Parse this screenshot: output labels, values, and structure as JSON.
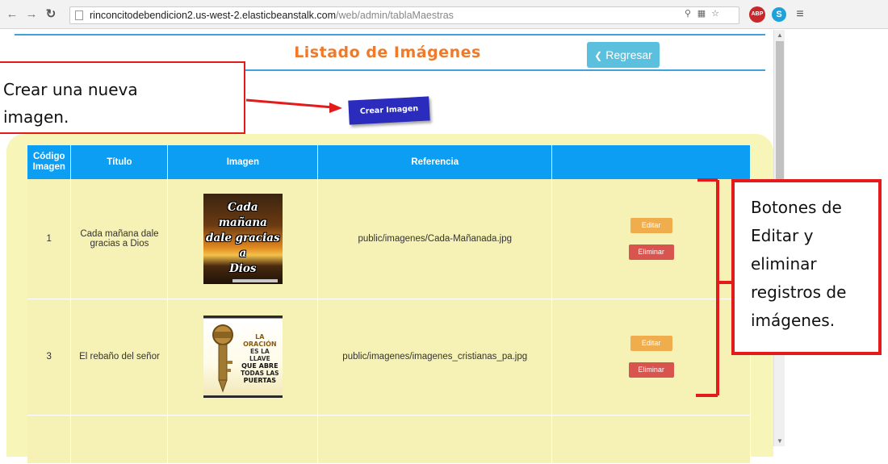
{
  "browser": {
    "url_host": "rinconcitodebendicion2.us-west-2.elasticbeanstalk.com",
    "url_path": "/web/admin/tablaMaestras"
  },
  "page": {
    "title": "Listado de Imágenes",
    "back_button_label": "Regresar",
    "create_button_label": "Crear Imagen"
  },
  "table": {
    "headers": [
      "Código Imagen",
      "Título",
      "Imagen",
      "Referencia",
      ""
    ],
    "rows": [
      {
        "code": "1",
        "title": "Cada mañana dale gracias a Dios",
        "image_text": [
          "Cada mañana",
          "dale gracias a",
          "Dios"
        ],
        "reference": "public/imagenes/Cada-Mañanada.jpg",
        "edit_label": "Editar",
        "delete_label": "Eliminar"
      },
      {
        "code": "3",
        "title": "El rebaño del señor",
        "image_text": [
          "LA ORACIÓN",
          "ES LA LLAVE",
          "QUE ABRE",
          "TODAS LAS",
          "PUERTAS"
        ],
        "reference": "public/imagenes/imagenes_cristianas_pa.jpg",
        "edit_label": "Editar",
        "delete_label": "Eliminar"
      }
    ]
  },
  "annotations": {
    "left_callout_line1": "Crear una nueva",
    "left_callout_line2": "imagen.",
    "right_callout_lines": [
      "Botones de",
      "Editar y",
      "eliminar",
      "registros de",
      "imágenes."
    ],
    "color": "#e31b1b"
  },
  "colors": {
    "header_blue": "#0b9ef3",
    "panel_yellow": "#f8f5b8",
    "title_orange": "#f07a2a",
    "back_button": "#5bc0de",
    "create_button": "#2b2bbd",
    "edit_button": "#f0ad4e",
    "delete_button": "#d9534f"
  },
  "icons": {
    "back": "arrow-left-icon",
    "forward": "arrow-right-icon",
    "reload": "reload-icon",
    "page": "page-icon",
    "zoom": "zoom-icon",
    "translate": "translate-icon",
    "bookmark": "star-icon",
    "adblock": "adblock-icon",
    "skype": "skype-icon",
    "menu": "menu-icon"
  }
}
